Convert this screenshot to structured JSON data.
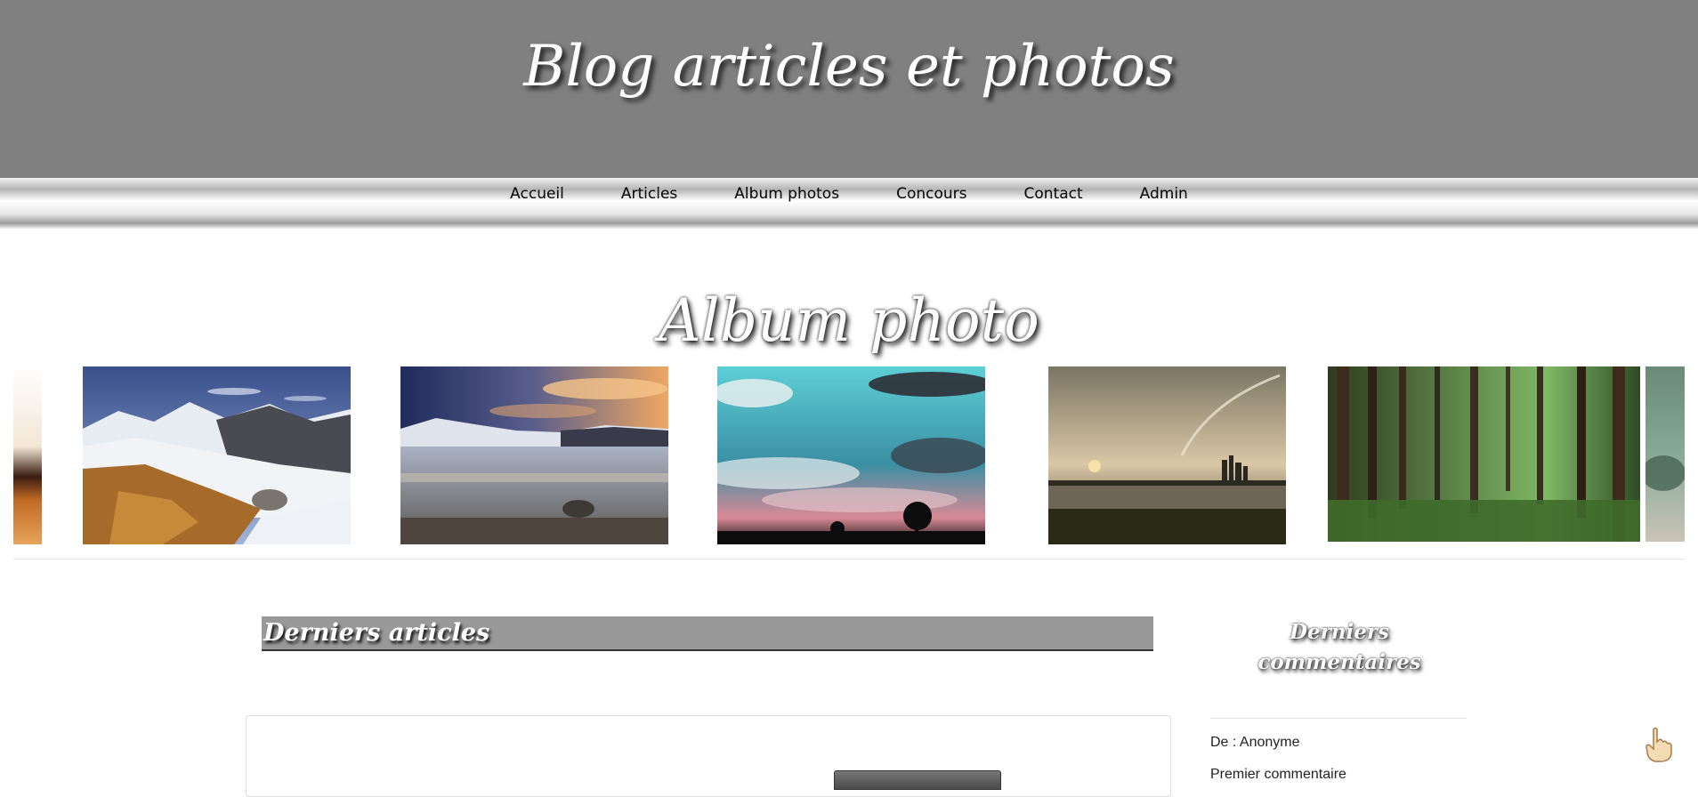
{
  "header": {
    "site_title": "Blog articles et photos",
    "background": "#808080"
  },
  "nav": {
    "items": [
      {
        "label": "Accueil"
      },
      {
        "label": "Articles"
      },
      {
        "label": "Album photos"
      },
      {
        "label": "Concours"
      },
      {
        "label": "Contact"
      },
      {
        "label": "Admin"
      }
    ]
  },
  "album": {
    "title": "Album photo",
    "photos": [
      {
        "subject": "sunset sky edge (partial)"
      },
      {
        "subject": "snowy mountains with dry grass"
      },
      {
        "subject": "frozen lake at sunset"
      },
      {
        "subject": "turquoise sky with clouds and tree silhouette"
      },
      {
        "subject": "sunset lake with distant city and planet ring"
      },
      {
        "subject": "green forest"
      },
      {
        "subject": "green hills (partial)"
      }
    ]
  },
  "articles": {
    "section_title": "Derniers articles"
  },
  "sidebar": {
    "title": "Derniers commentaires",
    "comments": [
      {
        "author_line": "De : Anonyme"
      },
      {
        "next_line": "Premier commentaire"
      }
    ]
  },
  "icons": {
    "scroll_top": "hand-pointer-icon"
  }
}
